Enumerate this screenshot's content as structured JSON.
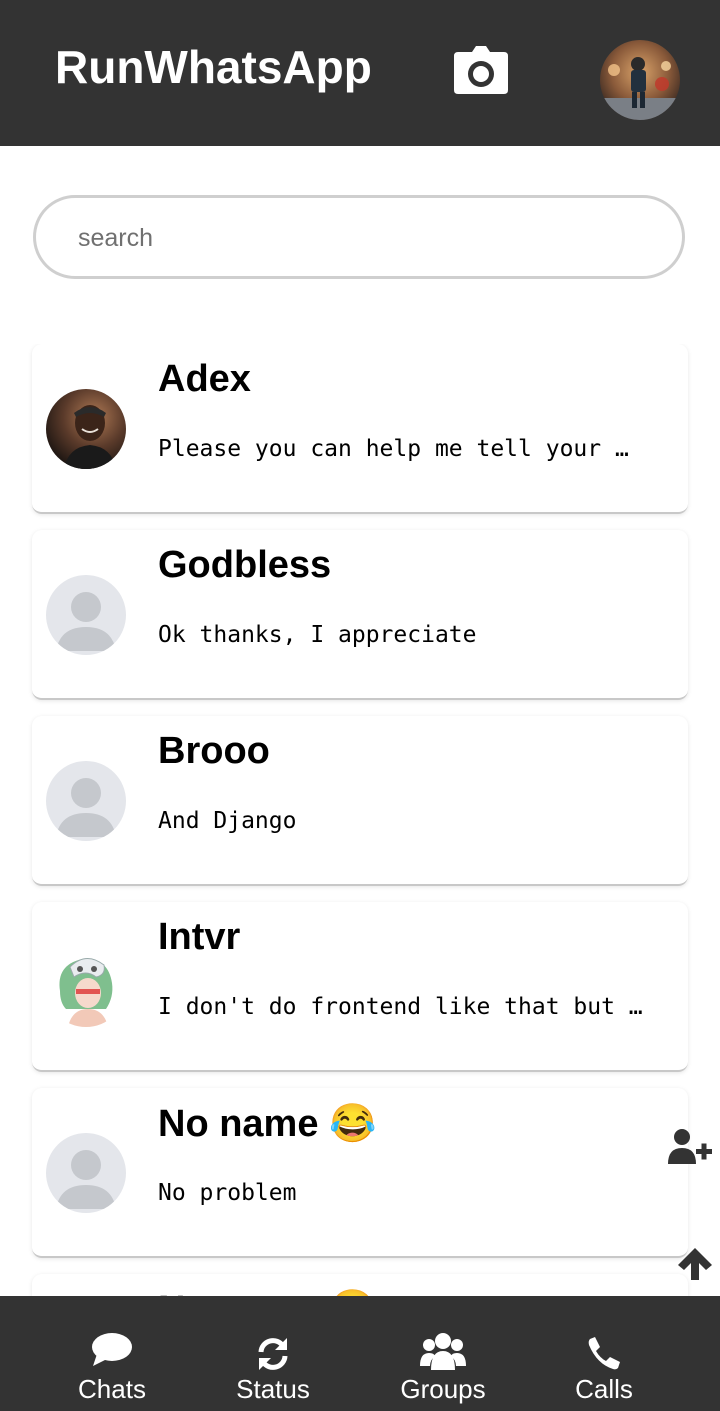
{
  "header": {
    "title": "RunWhatsApp",
    "camera_icon": "camera-icon",
    "profile_avatar": "profile-avatar-photo"
  },
  "search": {
    "placeholder": "search",
    "value": ""
  },
  "chats": [
    {
      "name": "Adex",
      "message": "Please you can help me tell your …",
      "avatar": "photo"
    },
    {
      "name": "Godbless",
      "message": "Ok thanks, I appreciate",
      "avatar": "default"
    },
    {
      "name": "Brooo",
      "message": "And Django",
      "avatar": "default"
    },
    {
      "name": "Intvr",
      "message": "I don't do frontend like that but …",
      "avatar": "anime"
    },
    {
      "name": "No name 😂",
      "message": "No problem",
      "avatar": "default"
    },
    {
      "name": "No name 😂",
      "message": "",
      "avatar": "default"
    }
  ],
  "side_actions": {
    "add_contact_icon": "user-plus-icon",
    "scroll_top_icon": "arrow-up-icon"
  },
  "nav": [
    {
      "label": "Chats",
      "icon": "chat-bubble-icon"
    },
    {
      "label": "Status",
      "icon": "refresh-icon"
    },
    {
      "label": "Groups",
      "icon": "users-icon"
    },
    {
      "label": "Calls",
      "icon": "phone-icon"
    }
  ],
  "colors": {
    "header_bg": "#333333",
    "nav_bg": "#333333",
    "default_avatar_bg": "#e4e6eb",
    "default_avatar_fg": "#c5c8cd"
  }
}
